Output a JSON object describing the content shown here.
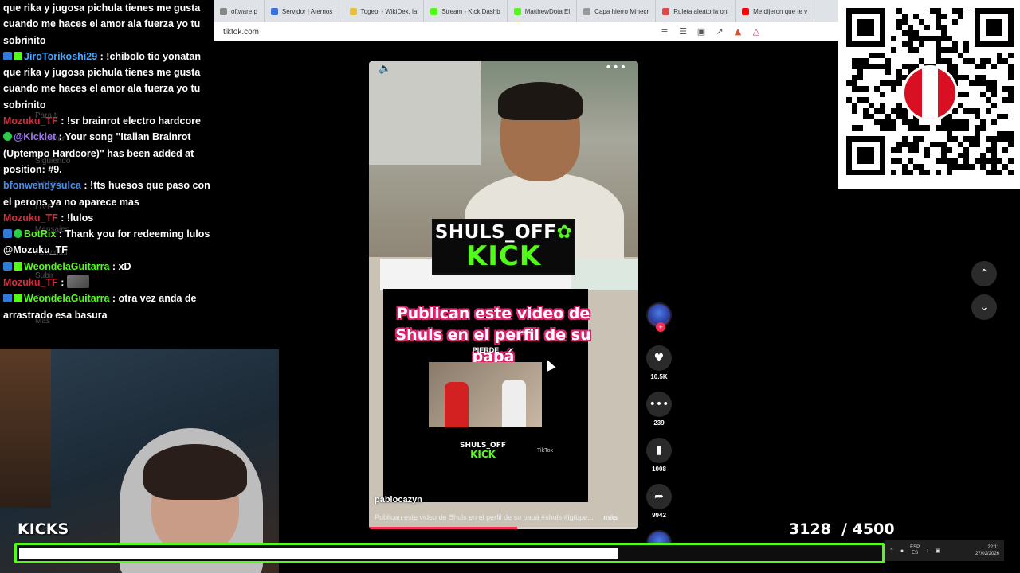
{
  "browser": {
    "tabs": [
      {
        "label": "oftware p",
        "color": "#888888"
      },
      {
        "label": "Servidor | Aternos |",
        "color": "#3d6fd8"
      },
      {
        "label": "Togepi - WikiDex, la",
        "color": "#e8c23a"
      },
      {
        "label": "Stream - Kick Dashb",
        "color": "#53fc18"
      },
      {
        "label": "MatthewDota El",
        "color": "#53fc18"
      },
      {
        "label": "Capa hierro Minecr",
        "color": "#999999"
      },
      {
        "label": "Ruleta aleatoria onl",
        "color": "#e04848"
      },
      {
        "label": "Me dijeron que te v",
        "color": "#ff0000"
      }
    ],
    "url": "tiktok.com"
  },
  "chat": {
    "messages": [
      {
        "badges": [],
        "user": "",
        "user_color": "#ffffff",
        "text": "que rika y jugosa pichula tienes me gusta cuando me haces el amor ala fuerza yo tu sobrinito"
      },
      {
        "badges": [
          "blue",
          "green"
        ],
        "user": "JiroTorikoshi29",
        "user_color": "#4aa6ff",
        "text": "!chibolo tio yonatan que rika y jugosa pichula tienes me gusta cuando me haces el amor ala fuerza yo tu sobrinito"
      },
      {
        "badges": [],
        "user": "Mozuku_TF",
        "user_color": "#d62b3c",
        "text": "!sr brainrot electro hardcore"
      },
      {
        "badges": [
          "greenc"
        ],
        "user": "@Kicklet",
        "user_color": "#a070ff",
        "text": "Your song \"Italian Brainrot (Uptempo Hardcore)\" has been added at position: #9."
      },
      {
        "badges": [],
        "user": "bfonwendysulca",
        "user_color": "#4a8de8",
        "text": "!tts huesos que paso con el perons ya no aparece mas"
      },
      {
        "badges": [],
        "user": "Mozuku_TF",
        "user_color": "#d62b3c",
        "text": "!lulos"
      },
      {
        "badges": [
          "blue",
          "greenc"
        ],
        "user": "BotRix",
        "user_color": "#53fc18",
        "text": "Thank you for redeeming lulos @Mozuku_TF"
      },
      {
        "badges": [
          "blue",
          "green"
        ],
        "user": "WeondelaGuitarra",
        "user_color": "#53fc18",
        "text": "xD"
      },
      {
        "badges": [],
        "user": "Mozuku_TF",
        "user_color": "#d62b3c",
        "text": "",
        "emote": true
      },
      {
        "badges": [
          "blue",
          "green"
        ],
        "user": "WeondelaGuitarra",
        "user_color": "#53fc18",
        "text": "otra vez anda de arrastrado esa basura"
      }
    ]
  },
  "tiktok_sidebar": [
    "Para ti",
    "Explorar",
    "Siguiendo",
    "Amigos",
    "LIVE",
    "Mensajes",
    "Actividad",
    "Subir",
    "Perfil",
    "Más"
  ],
  "video": {
    "overlay_top": "SHULS_OFF",
    "overlay_bottom": "KICK",
    "headline": "Publican este video de Shuls en el perfil de su papá",
    "pierde": "PIERDE",
    "inner_kick_top": "SHULS_OFF",
    "inner_kick_bottom": "KICK",
    "inner_tiktok": "TikTok",
    "author": "pablocazyn",
    "caption": "Publican este video de Shuls en el perfil de su papá #shuls #lgtbpe...",
    "caption_more": "más",
    "progress_percent": 55
  },
  "actions": {
    "likes": "10.5K",
    "comments": "239",
    "saves": "1008",
    "shares": "9942"
  },
  "overlay": {
    "kicks_label": "KICKS",
    "goal_current": "3128",
    "goal_target": "/ 4500",
    "goal_value": 3128,
    "goal_max": 4500
  },
  "tray": {
    "lang_top": "ESP",
    "lang_bottom": "ES",
    "time": "22:11",
    "date": "27/02/2026"
  },
  "colors": {
    "kick_green": "#53fc18",
    "tiktok_red": "#fe2c55"
  }
}
